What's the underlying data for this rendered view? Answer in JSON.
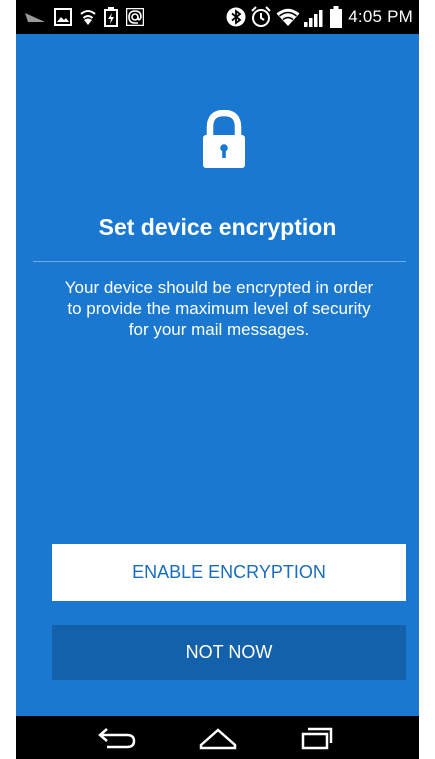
{
  "status_bar": {
    "time": "4:05 PM",
    "left_icons": [
      "notification-icon",
      "image-icon",
      "wifi-notification-icon",
      "battery-notification-icon",
      "email-at-icon"
    ],
    "right_icons": [
      "bluetooth-icon",
      "alarm-icon",
      "wifi-icon",
      "signal-icon",
      "battery-icon"
    ]
  },
  "screen": {
    "icon": "lock-icon",
    "title": "Set device encryption",
    "description": "Your device should be encrypted in order to provide the maximum level of security for your mail messages."
  },
  "actions": {
    "enable_label": "ENABLE ENCRYPTION",
    "not_now_label": "NOT NOW"
  },
  "nav_bar": {
    "buttons": [
      "back-icon",
      "home-icon",
      "recent-apps-icon"
    ]
  },
  "colors": {
    "background": "#1a78d1",
    "primary_button_bg": "#ffffff",
    "primary_button_text": "#1a6dbd",
    "secondary_button_bg": "#1461ab",
    "bars": "#000000"
  }
}
